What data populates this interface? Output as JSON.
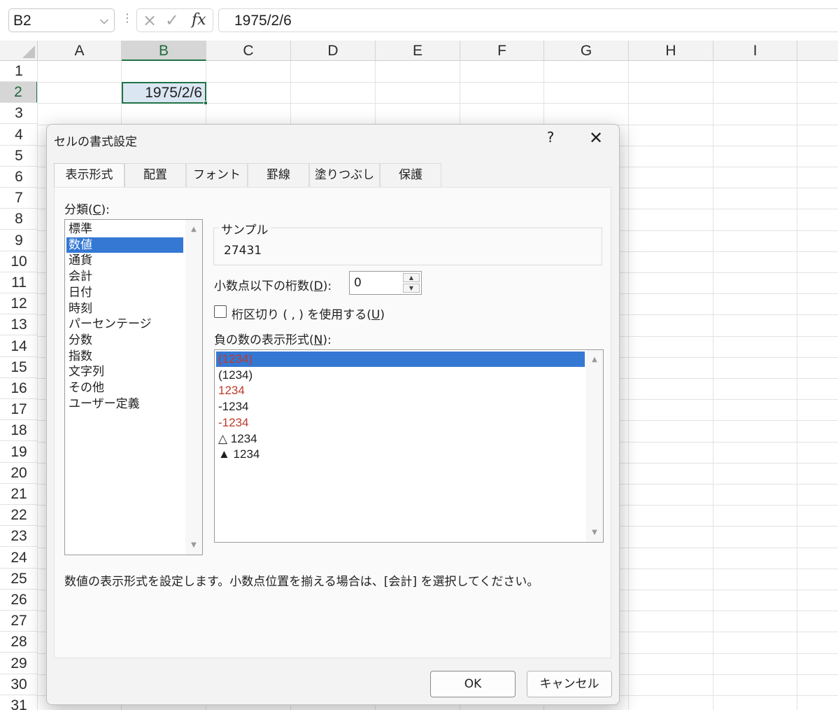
{
  "formula_bar": {
    "name_box": "B2",
    "cancel_icon": "×",
    "enter_icon": "✓",
    "fx_label": "fx",
    "value": "1975/2/6"
  },
  "sheet": {
    "columns": [
      "A",
      "B",
      "C",
      "D",
      "E",
      "F",
      "G",
      "H",
      "I"
    ],
    "rows": [
      "1",
      "2",
      "3",
      "4",
      "5",
      "6",
      "7",
      "8",
      "9",
      "10",
      "11",
      "12",
      "13",
      "14",
      "15",
      "16",
      "17",
      "18",
      "19",
      "20",
      "21",
      "22",
      "23",
      "24",
      "25",
      "26",
      "27",
      "28",
      "29",
      "30",
      "31"
    ],
    "selected_cell": "B2",
    "selected_cell_value": "1975/2/6",
    "accent_color": "#217346"
  },
  "dialog": {
    "title": "セルの書式設定",
    "help_label": "?",
    "close_label": "✕",
    "tabs": [
      {
        "label": "表示形式",
        "active": true
      },
      {
        "label": "配置",
        "active": false
      },
      {
        "label": "フォント",
        "active": false
      },
      {
        "label": "罫線",
        "active": false
      },
      {
        "label": "塗りつぶし",
        "active": false
      },
      {
        "label": "保護",
        "active": false
      }
    ],
    "category_label_pre": "分類(",
    "category_label_key": "C",
    "category_label_post": "):",
    "categories": [
      "標準",
      "数値",
      "通貨",
      "会計",
      "日付",
      "時刻",
      "パーセンテージ",
      "分数",
      "指数",
      "文字列",
      "その他",
      "ユーザー定義"
    ],
    "selected_category": "数値",
    "sample_label": "サンプル",
    "sample_value": "27431",
    "decimal_label_pre": "小数点以下の桁数(",
    "decimal_label_key": "D",
    "decimal_label_post": "):",
    "decimal_value": "0",
    "separator_label_pre": "桁区切り ( , ) を使用する(",
    "separator_label_key": "U",
    "separator_label_post": ")",
    "separator_checked": false,
    "negative_label_pre": "負の数の表示形式(",
    "negative_label_key": "N",
    "negative_label_post": "):",
    "negative_formats": [
      {
        "text": "(1234)",
        "color": "red",
        "selected": true
      },
      {
        "text": "(1234)",
        "color": "black",
        "selected": false
      },
      {
        "text": "1234",
        "color": "red",
        "selected": false
      },
      {
        "text": "-1234",
        "color": "black",
        "selected": false
      },
      {
        "text": "-1234",
        "color": "red",
        "selected": false
      },
      {
        "text": "△ 1234",
        "color": "black",
        "selected": false
      },
      {
        "text": "▲ 1234",
        "color": "black",
        "selected": false
      }
    ],
    "description": "数値の表示形式を設定します。小数点位置を揃える場合は、[会計] を選択してください。",
    "ok_label": "OK",
    "cancel_label": "キャンセル",
    "selection_color": "#3478d4",
    "negative_red_color": "#c0392b"
  }
}
